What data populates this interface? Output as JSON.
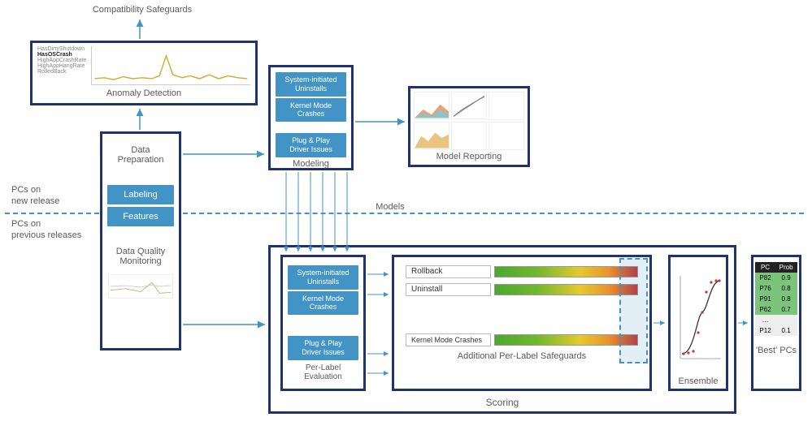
{
  "top_label": "Compatibility Safeguards",
  "anomaly": {
    "title": "Anomaly Detection",
    "legend": [
      "HasDirtyShutdown",
      "HasOSCrash",
      "HighAppCrashRate",
      "HighAppHangRate",
      "RolledBack"
    ]
  },
  "dataprep": {
    "title1": "Data",
    "title2": "Preparation",
    "labeling": "Labeling",
    "features": "Features",
    "dqm1": "Data Quality",
    "dqm2": "Monitoring"
  },
  "modeling": {
    "title": "Modeling",
    "pills": [
      "System-initiated\nUninstalls",
      "Kernel Mode\nCrashes",
      "Plug & Play\nDriver Issues"
    ]
  },
  "reporting": {
    "title": "Model Reporting"
  },
  "side": {
    "top1": "PCs on",
    "top2": "new release",
    "bot1": "PCs on",
    "bot2": "previous releases"
  },
  "models_lbl": "Models",
  "scoring": {
    "title": "Scoring",
    "ple": {
      "title": "Per-Label\nEvaluation",
      "pills": [
        "System-initiated\nUninstalls",
        "Kernel Mode\nCrashes",
        "Plug & Play\nDriver Issues"
      ]
    },
    "safeguards": {
      "title": "Additional Per-Label Safeguards",
      "bars": [
        "Rollback",
        "Uninstall",
        "Kernel Mode Crashes"
      ]
    },
    "ensemble": {
      "title": "Ensemble"
    }
  },
  "best": {
    "title": "'Best' PCs",
    "rows": [
      [
        "P82",
        "0.9"
      ],
      [
        "P76",
        "0.8"
      ],
      [
        "P91",
        "0.8"
      ],
      [
        "P62",
        "0.7"
      ],
      [
        "…",
        ""
      ],
      [
        "P12",
        "0.1"
      ]
    ],
    "headers": [
      "PC",
      "Prob"
    ],
    "grey_from": 4
  },
  "chart_data": [
    {
      "type": "line",
      "title": "Anomaly Detection",
      "series": [
        {
          "name": "HasOSCrash",
          "description": "low noisy baseline with one spike mid-series"
        }
      ]
    },
    {
      "type": "line",
      "title": "Ensemble",
      "description": "sigmoid s-curve, y approx 0 to 1"
    }
  ]
}
